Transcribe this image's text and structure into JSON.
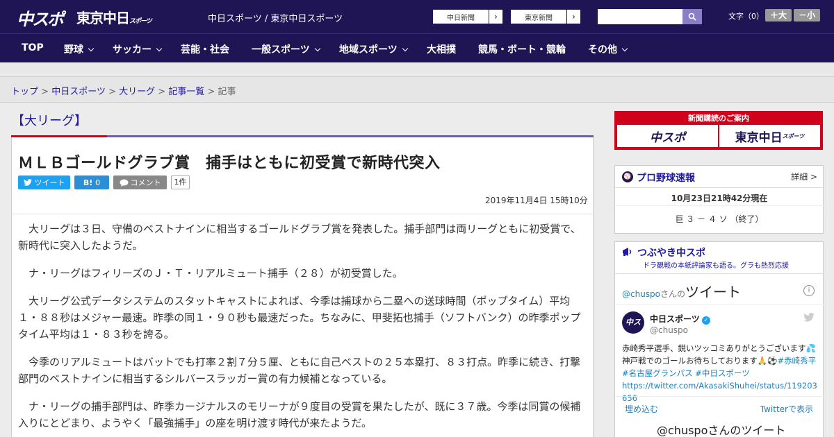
{
  "header": {
    "logo_chuspo": "中スポ",
    "logo_tokyo": "東京中日",
    "logo_tokyo_small": "スポーツ",
    "site_title": "中日スポーツ / 東京中日スポーツ",
    "link_chunichi": "中日新聞",
    "link_tokyo": "東京新聞",
    "search_placeholder": "",
    "font_label": "文字（0）",
    "font_bigger": "＋大",
    "font_smaller": "－小"
  },
  "nav": {
    "items": [
      "TOP",
      "野球",
      "サッカー",
      "芸能・社会",
      "一般スポーツ",
      "地域スポーツ",
      "大相撲",
      "競馬・ボート・競輪",
      "その他"
    ]
  },
  "breadcrumb": {
    "items": [
      "トップ",
      "中日スポーツ",
      "大リーグ",
      "記事一覧"
    ],
    "current": "記事",
    "sep": ">"
  },
  "article": {
    "category": "【大リーグ】",
    "headline": "ＭＬＢゴールドグラブ賞　捕手はともに初受賞で新時代突入",
    "tweet_label": "ツイート",
    "hatena_label": "B!",
    "hatena_count": "0",
    "comment_label": "コメント",
    "comment_count": "1件",
    "date": "2019年11月4日 15時10分",
    "paragraphs": [
      "大リーグは３日、守備のベストナインに相当するゴールドグラブ賞を発表した。捕手部門は両リーグともに初受賞で、新時代に突入したようだ。",
      "ナ・リーグはフィリーズのＪ・Ｔ・リアルミュート捕手（２８）が初受賞した。",
      "大リーグ公式データシステムのスタットキャストによれば、今季は捕球から二塁への送球時間（ポップタイム）平均１・８８秒はメジャー最速。昨季の同１・９０秒も最速だった。ちなみに、甲斐拓也捕手（ソフトバンク）の昨季ポップタイム平均は１・８３秒を誇る。",
      "今季のリアルミュートはバットでも打率２割７分５厘、ともに自己ベストの２５本塁打、８３打点。昨季に続き、打撃部門のベストナインに相当するシルバースラッガー賞の有力候補となっている。",
      "ナ・リーグの捕手部門は、昨季カージナルスのモリーナが９度目の受賞を果たしたが、既に３７歳。今季は同賞の候補入りにとどまり、ようやく「最強捕手」の座を明け渡す時代が来たようだ。"
    ]
  },
  "sidebar": {
    "promo_title": "新聞購読のご案内",
    "promo_chuspo": "中スポ",
    "promo_tokyo": "東京中日",
    "promo_tokyo_small": "スポーツ",
    "score": {
      "title": "プロ野球速報",
      "more": "詳細 >",
      "time": "10月23日21時42分現在",
      "line": "巨 ３ － ４ ソ （終了）"
    },
    "twitter": {
      "title": "つぶやき中スポ",
      "subtitle": "ドラ観戦の本紙評論家も語る。グラも熱烈応援",
      "handle_prefix": "@chuspo",
      "handle_suffix": "さんの",
      "tweets_word": "ツイート",
      "name": "中日スポーツ",
      "handle": "@chuspo",
      "avatar_text": "中スポ",
      "text_plain": "赤崎秀平選手、鋭いツッコミありがとうございます💦神戸戦でのゴールお待ちしております🙏⚽",
      "text_hash": "#赤崎秀平 #名古屋グランパス #中日スポーツ",
      "text_url": "https://twitter.com/AkasakiShuhei/status/119203656",
      "embed": "埋め込む",
      "view": "Twitterで表示",
      "more": "@chuspoさんのツイート"
    }
  },
  "colors": {
    "navy": "#1f1554",
    "accent_red": "#d0021b",
    "link": "#1f1aa0",
    "twitter_blue": "#1da1f2"
  }
}
